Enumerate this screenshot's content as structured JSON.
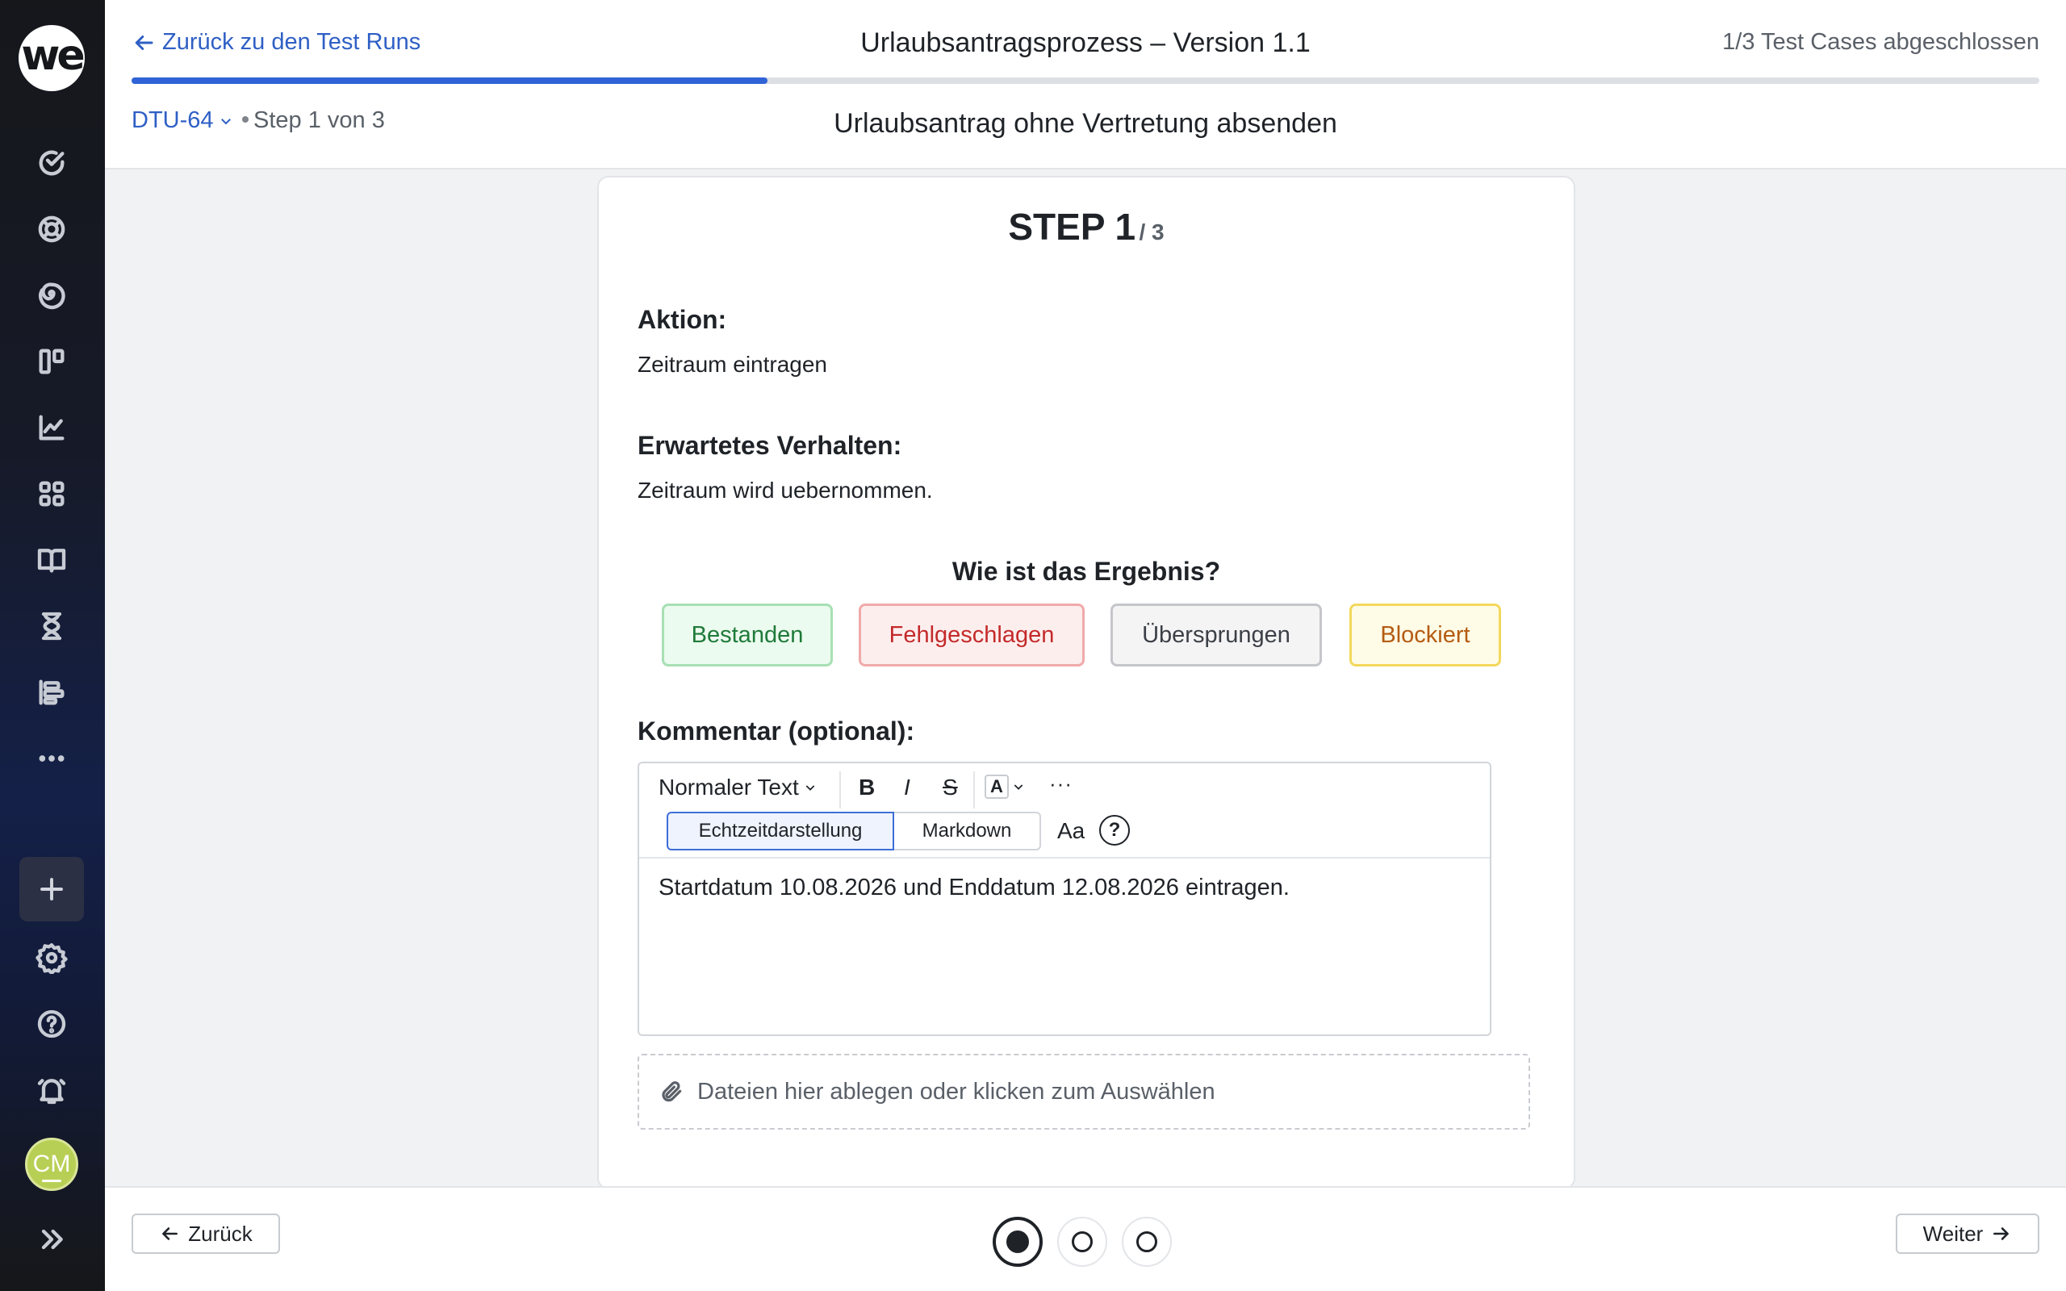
{
  "sidebar": {
    "logo_text": "we",
    "items": [
      {
        "icon": "check-circle-icon"
      },
      {
        "icon": "lifebuoy-icon"
      },
      {
        "icon": "spiral-icon"
      },
      {
        "icon": "board-icon"
      },
      {
        "icon": "chart-line-icon"
      },
      {
        "icon": "grid-icon"
      },
      {
        "icon": "book-icon"
      },
      {
        "icon": "hourglass-icon"
      },
      {
        "icon": "timeline-icon"
      },
      {
        "icon": "more-icon"
      }
    ],
    "add_icon": "plus-icon",
    "bottom_items": [
      {
        "icon": "gear-icon"
      },
      {
        "icon": "help-icon"
      },
      {
        "icon": "bell-icon"
      }
    ],
    "avatar_initials": "CM",
    "expand_icon": "chevrons-right-icon"
  },
  "header": {
    "back_label": "Zurück zu den Test Runs",
    "run_title": "Urlaubsantragsprozess – Version 1.1",
    "progress_text": "1/3 Test Cases abgeschlossen",
    "progress_fraction": 0.3333,
    "case_id": "DTU-64",
    "step_of": "Step 1 von 3",
    "case_title": "Urlaubsantrag ohne Vertretung absenden"
  },
  "step": {
    "heading": "STEP 1",
    "total": "/ 3",
    "action_label": "Aktion:",
    "action_text": "Zeitraum eintragen",
    "expected_label": "Erwartetes Verhalten:",
    "expected_text": "Zeitraum wird uebernommen.",
    "question": "Wie ist das Ergebnis?",
    "results": {
      "passed": "Bestanden",
      "failed": "Fehlgeschlagen",
      "skipped": "Übersprungen",
      "blocked": "Blockiert"
    },
    "comment_label": "Kommentar (optional):"
  },
  "editor": {
    "text_style": "Normaler Text",
    "bold": "B",
    "italic": "I",
    "strike": "S",
    "color_letter": "A",
    "more": "···",
    "mode_live": "Echtzeitdarstellung",
    "mode_markdown": "Markdown",
    "aa": "Aa",
    "help": "?",
    "content": "Startdatum 10.08.2026 und Enddatum 12.08.2026 eintragen."
  },
  "dropzone": {
    "text": "Dateien hier ablegen oder klicken zum Auswählen"
  },
  "footer": {
    "back_label": "Zurück",
    "next_label": "Weiter",
    "steps": 3,
    "current_step": 1
  },
  "colors": {
    "accent": "#2f63d6",
    "link": "#2f5fc5",
    "passed": "#1f7a3a",
    "failed": "#c42a2a",
    "blocked": "#b55b12"
  }
}
